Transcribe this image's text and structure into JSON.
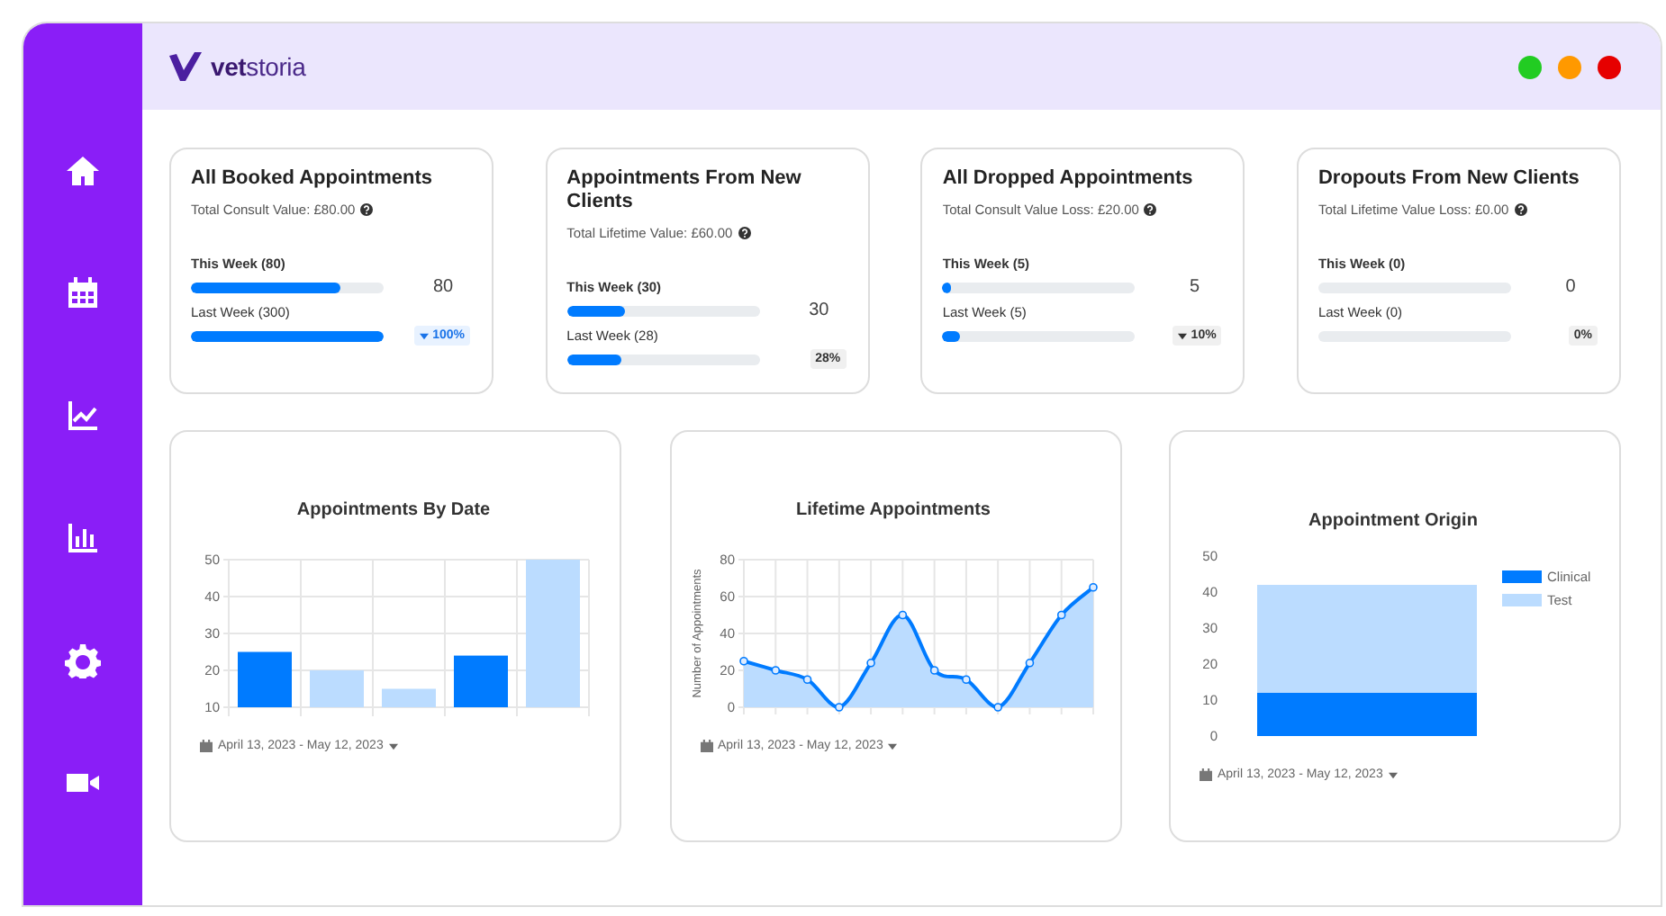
{
  "header": {
    "logo": "**vet**storia",
    "window_dots": [
      {
        "color": "#22cc22"
      },
      {
        "color": "#ff9900"
      },
      {
        "color": "#e60000"
      }
    ]
  },
  "stat_cards": [
    {
      "title": "All Booked Appointments",
      "subtitle": "Total Consult Value: £80.00",
      "this_week": {
        "label": "This Week (80)",
        "level": 0.78
      },
      "value": "80",
      "last_week": {
        "label": "Last Week (300)",
        "level": 1
      },
      "change": {
        "text": "100%",
        "caret": true,
        "highlighted": true
      }
    },
    {
      "title": "Appointments From New Clients",
      "subtitle": "Total Lifetime Value: £60.00",
      "this_week": {
        "label": "This Week (30)",
        "level": 0.3
      },
      "value": "30",
      "last_week": {
        "label": "Last Week (28)",
        "level": 0.28
      },
      "change": {
        "text": "28%",
        "caret": false,
        "highlighted": false
      }
    },
    {
      "title": "All Dropped Appointments",
      "subtitle": "Total Consult Value Loss: £20.00",
      "this_week": {
        "label": "This Week (5)",
        "level": 0.04
      },
      "value": "5",
      "last_week": {
        "label": "Last Week (5)",
        "level": 0.09
      },
      "change": {
        "text": "10%",
        "caret": true,
        "highlighted": false
      }
    },
    {
      "title": "Dropouts From New Clients",
      "subtitle": "Total Lifetime Value Loss: £0.00",
      "this_week": {
        "label": "This Week (0)",
        "level": 0
      },
      "value": "0",
      "last_week": {
        "label": "Last Week (0)",
        "level": 0
      },
      "change": {
        "text": "0%",
        "caret": false,
        "highlighted": false
      }
    }
  ],
  "charts": [
    {
      "date_range": "April 13, 2023 - May 12, 2023",
      "chart_data": {
        "type": "bar",
        "title": "Appointments By Date",
        "grid": true,
        "series": [
          {
            "color": "#007bff",
            "values": [
              25,
              null,
              null,
              24,
              null
            ]
          },
          {
            "color": "#bbdcff",
            "values": [
              null,
              20,
              15,
              null,
              50
            ]
          }
        ],
        "ylim": [
          10,
          50
        ],
        "yticks": [
          10,
          20,
          30,
          40,
          50
        ]
      }
    },
    {
      "date_range": "April 13, 2023 - May 12, 2023",
      "chart_data": {
        "type": "area",
        "title": "Lifetime Appointments",
        "ylabel": "Number of Appointments",
        "grid": true,
        "values": [
          25,
          20,
          15,
          0,
          24,
          50,
          20,
          15,
          0,
          24,
          50,
          65
        ],
        "ylim": [
          0,
          80
        ],
        "yticks": [
          0,
          20,
          40,
          60,
          80
        ]
      }
    },
    {
      "date_range": "April 13, 2023 - May 12, 2023",
      "chart_data": {
        "type": "bar",
        "stacked": true,
        "legend": "right",
        "title": "Appointment Origin",
        "series": [
          {
            "name": "Clinical",
            "color": "#007bff",
            "values": [
              12
            ]
          },
          {
            "name": "Test",
            "color": "#bbdcff",
            "values": [
              30
            ]
          }
        ],
        "ylim": [
          0,
          50
        ],
        "yticks": [
          0,
          10,
          20,
          30,
          40,
          50
        ]
      }
    }
  ]
}
